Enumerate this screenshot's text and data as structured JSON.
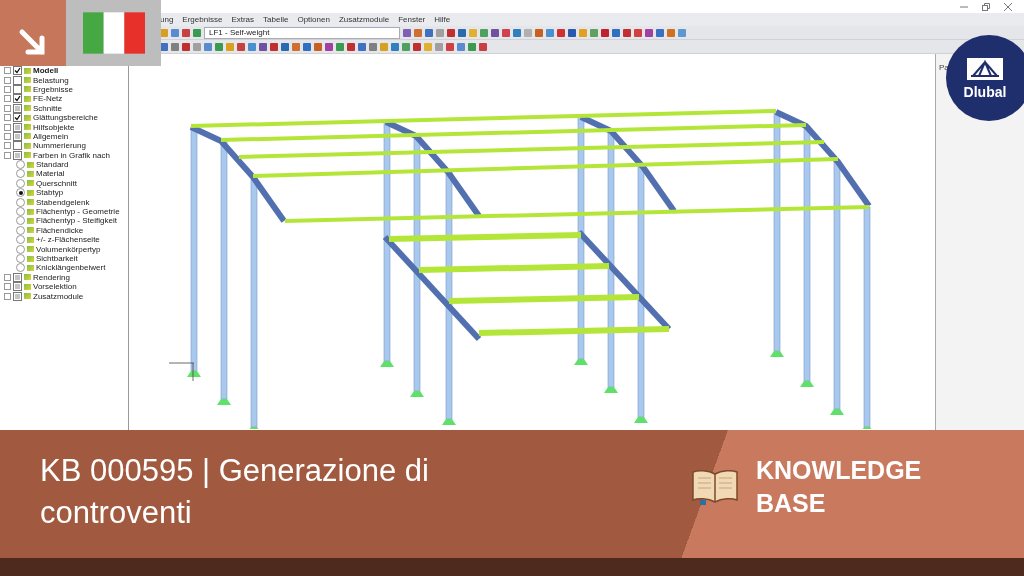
{
  "window": {
    "menu": [
      "ung",
      "Ergebnisse",
      "Extras",
      "Tabelle",
      "Optionen",
      "Zusatzmodule",
      "Fenster",
      "Hilfe"
    ],
    "load_case": "LF1 - Self-weight"
  },
  "tree": [
    {
      "label": "Modell",
      "checked": true,
      "partial": false,
      "bold": true
    },
    {
      "label": "Belastung",
      "checked": false,
      "partial": false,
      "bold": false
    },
    {
      "label": "Ergebnisse",
      "checked": false,
      "partial": false,
      "bold": false
    },
    {
      "label": "FE-Netz",
      "checked": true,
      "partial": false,
      "bold": false
    },
    {
      "label": "Schnitte",
      "checked": false,
      "partial": true,
      "bold": false
    },
    {
      "label": "Glättungsbereiche",
      "checked": true,
      "partial": false,
      "bold": false
    },
    {
      "label": "Hilfsobjekte",
      "checked": false,
      "partial": true,
      "bold": false
    },
    {
      "label": "Allgemein",
      "checked": false,
      "partial": true,
      "bold": false
    },
    {
      "label": "Nummerierung",
      "checked": false,
      "partial": false,
      "bold": false
    },
    {
      "label": "Farben in Grafik nach",
      "checked": false,
      "partial": true,
      "bold": false,
      "children": [
        {
          "label": "Standard",
          "selected": false
        },
        {
          "label": "Material",
          "selected": false
        },
        {
          "label": "Querschnitt",
          "selected": false
        },
        {
          "label": "Stabtyp",
          "selected": true
        },
        {
          "label": "Stabendgelenk",
          "selected": false
        },
        {
          "label": "Flächentyp - Geometrie",
          "selected": false
        },
        {
          "label": "Flächentyp - Steifigkeit",
          "selected": false
        },
        {
          "label": "Flächendicke",
          "selected": false
        },
        {
          "label": "+/- z-Flächenseite",
          "selected": false
        },
        {
          "label": "Volumenkörpertyp",
          "selected": false
        },
        {
          "label": "Sichtbarkeit",
          "selected": false
        },
        {
          "label": "Knicklängenbeiwert",
          "selected": false
        }
      ]
    },
    {
      "label": "Rendering",
      "checked": false,
      "partial": true,
      "bold": false
    },
    {
      "label": "Vorselektion",
      "checked": false,
      "partial": true,
      "bold": false
    },
    {
      "label": "Zusatzmodule",
      "checked": false,
      "partial": true,
      "bold": false
    }
  ],
  "side_panel": {
    "title": "Pa"
  },
  "logo": {
    "text": "Dlubal"
  },
  "banner": {
    "title": "KB 000595 | Generazione di controventi",
    "category": "KNOWLEDGE BASE"
  }
}
